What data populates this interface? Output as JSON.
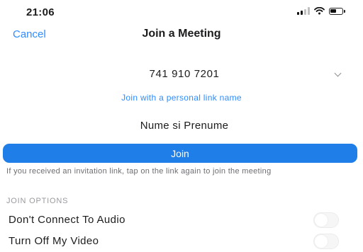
{
  "status_bar": {
    "time": "21:06",
    "icons": [
      "signal-icon",
      "wifi-icon",
      "battery-icon"
    ]
  },
  "nav": {
    "cancel_label": "Cancel",
    "title": "Join a Meeting"
  },
  "meeting": {
    "id_value": "741 910 7201",
    "personal_link_label": "Join with a personal link name",
    "name_value": "Nume si Prenume"
  },
  "join_button": {
    "label": "Join"
  },
  "hint_text": "If you received an invitation link, tap on the link again to join the meeting",
  "join_options": {
    "header": "JOIN OPTIONS",
    "options": [
      {
        "label": "Don't Connect To Audio",
        "enabled": false
      },
      {
        "label": "Turn Off My Video",
        "enabled": false
      }
    ]
  },
  "colors": {
    "accent": "#2d8cff",
    "join_button": "#1f7ee8",
    "text": "#1c1c1e",
    "muted": "#6d6d72"
  }
}
